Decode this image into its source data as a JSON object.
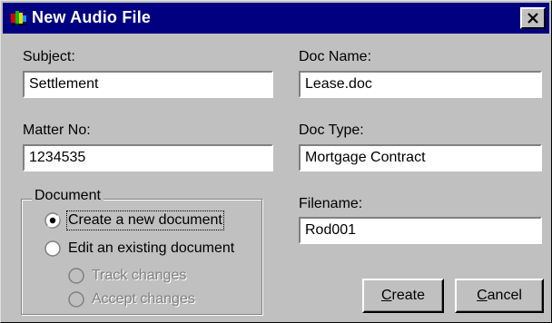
{
  "window": {
    "title": "New Audio File"
  },
  "fields": {
    "subject": {
      "label": "Subject:",
      "value": "Settlement"
    },
    "doc_name": {
      "label": "Doc Name:",
      "value": "Lease.doc"
    },
    "matter_no": {
      "label": "Matter No:",
      "value": "1234535"
    },
    "doc_type": {
      "label": "Doc Type:",
      "value": "Mortgage Contract"
    },
    "filename": {
      "label": "Filename:",
      "value": "Rod001"
    }
  },
  "document_group": {
    "legend": "Document",
    "options": [
      {
        "label": "Create a new document",
        "selected": true,
        "enabled": true
      },
      {
        "label": "Edit an existing document",
        "selected": false,
        "enabled": true
      },
      {
        "label": "Track changes",
        "selected": false,
        "enabled": false
      },
      {
        "label": "Accept changes",
        "selected": false,
        "enabled": false
      }
    ]
  },
  "buttons": {
    "create": {
      "label": "Create",
      "mnemonic_first": "C",
      "rest": "reate"
    },
    "cancel": {
      "label": "Cancel",
      "mnemonic_first": "C",
      "rest": "ancel"
    }
  },
  "icons": {
    "app": "audio-file-icon",
    "close": "close-icon"
  }
}
